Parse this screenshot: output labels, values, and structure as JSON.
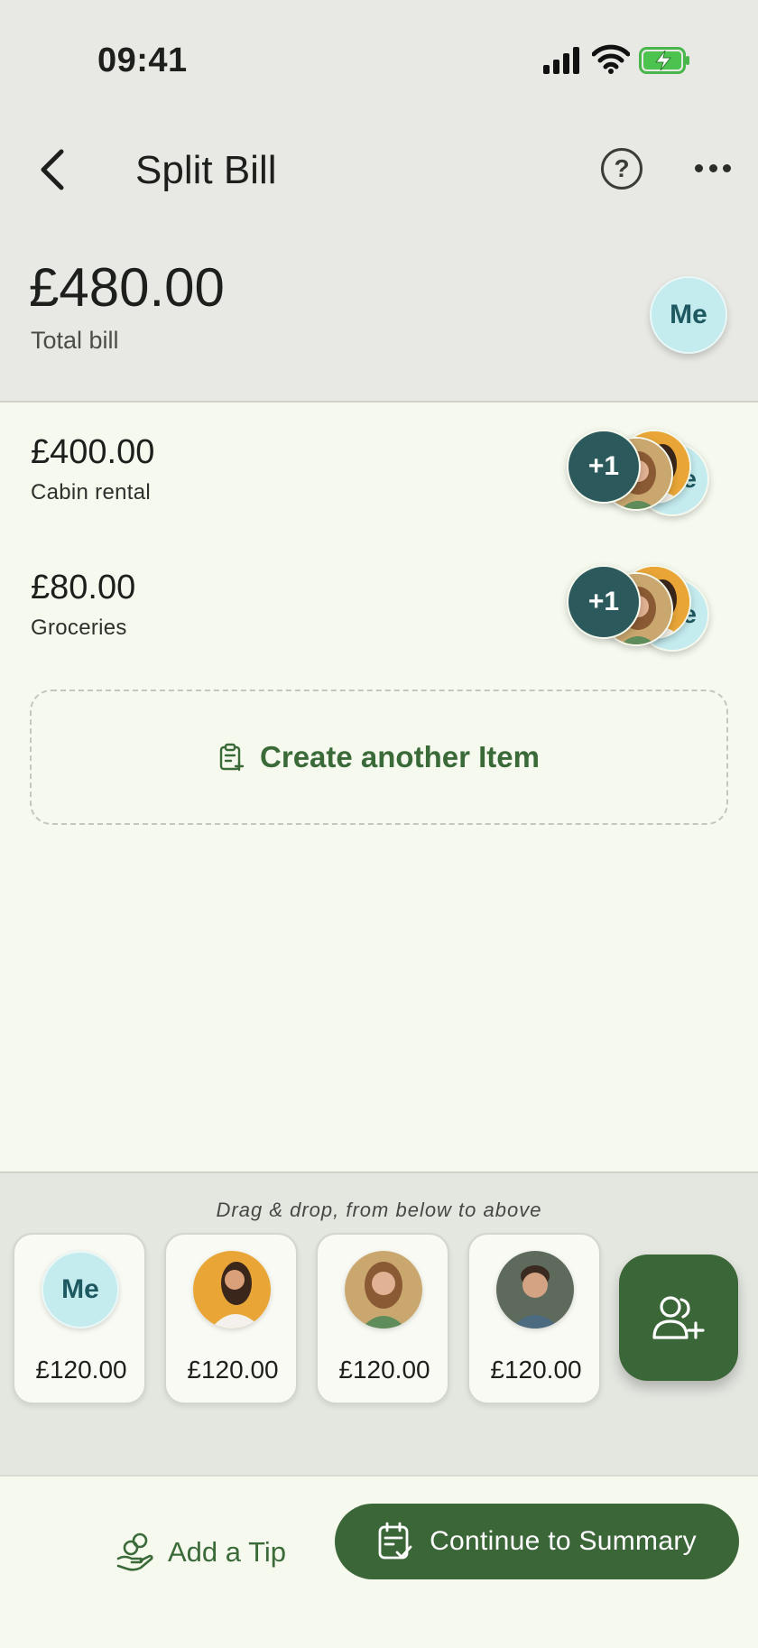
{
  "status_bar": {
    "time": "09:41"
  },
  "header": {
    "title": "Split Bill"
  },
  "summary": {
    "total_amount": "£480.00",
    "total_label": "Total bill",
    "owner_avatar": "Me"
  },
  "items": [
    {
      "amount": "£400.00",
      "name": "Cabin rental",
      "overflow": "+1",
      "me_avatar": "e"
    },
    {
      "amount": "£80.00",
      "name": "Groceries",
      "overflow": "+1",
      "me_avatar": "e"
    }
  ],
  "create_item_label": "Create another Item",
  "tray": {
    "hint": "Drag & drop, from below to above",
    "people": [
      {
        "avatar_text": "Me",
        "amount": "£120.00"
      },
      {
        "avatar_text": "",
        "amount": "£120.00"
      },
      {
        "avatar_text": "",
        "amount": "£120.00"
      },
      {
        "avatar_text": "",
        "amount": "£120.00"
      }
    ]
  },
  "footer": {
    "tip_label": "Add a Tip",
    "continue_label": "Continue to Summary"
  },
  "icons": {
    "back": "chevron-left-icon",
    "help": "question-circle-icon",
    "more": "more-horizontal-icon",
    "create": "clipboard-plus-icon",
    "add_person": "user-plus-icon",
    "tip": "hand-coins-icon",
    "continue": "calendar-check-icon"
  },
  "colors": {
    "primary": "#3b6638",
    "accent_text": "#3b6a39",
    "me_avatar_bg": "#c4ebee",
    "overflow_badge": "#2c5a5c",
    "content_bg": "#f6f9ee",
    "header_bg": "#e8e9e4"
  }
}
